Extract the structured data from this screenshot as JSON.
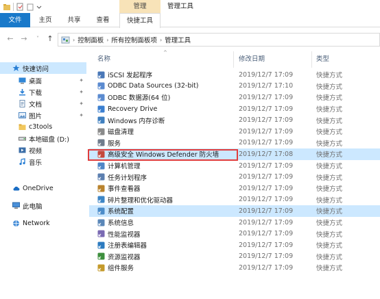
{
  "ribbon": {
    "context_group": "管理",
    "window_title": "管理工具",
    "tabs": [
      {
        "label": "文件"
      },
      {
        "label": "主页"
      },
      {
        "label": "共享"
      },
      {
        "label": "查看"
      },
      {
        "label": "快捷工具"
      }
    ]
  },
  "address": {
    "crumbs": [
      "控制面板",
      "所有控制面板项",
      "管理工具"
    ]
  },
  "nav": {
    "items": [
      {
        "label": "快速访问",
        "icon": "star-icon"
      },
      {
        "label": "桌面",
        "icon": "desktop-icon",
        "pinned": true
      },
      {
        "label": "下载",
        "icon": "download-icon",
        "pinned": true
      },
      {
        "label": "文档",
        "icon": "document-icon",
        "pinned": true
      },
      {
        "label": "图片",
        "icon": "picture-icon",
        "pinned": true
      },
      {
        "label": "c3tools",
        "icon": "folder-icon"
      },
      {
        "label": "本地磁盘 (D:)",
        "icon": "drive-icon"
      },
      {
        "label": "视频",
        "icon": "video-icon"
      },
      {
        "label": "音乐",
        "icon": "music-icon"
      },
      {
        "label": "OneDrive",
        "icon": "cloud-icon"
      },
      {
        "label": "此电脑",
        "icon": "computer-icon"
      },
      {
        "label": "Network",
        "icon": "network-icon"
      }
    ]
  },
  "list": {
    "headers": {
      "name": "名称",
      "date": "修改日期",
      "type": "类型"
    },
    "rows": [
      {
        "name": "iSCSI 发起程序",
        "date": "2019/12/7 17:09",
        "type": "快捷方式"
      },
      {
        "name": "ODBC Data Sources (32-bit)",
        "date": "2019/12/7 17:10",
        "type": "快捷方式"
      },
      {
        "name": "ODBC 数据源(64 位)",
        "date": "2019/12/7 17:09",
        "type": "快捷方式"
      },
      {
        "name": "Recovery Drive",
        "date": "2019/12/7 17:09",
        "type": "快捷方式"
      },
      {
        "name": "Windows 内存诊断",
        "date": "2019/12/7 17:09",
        "type": "快捷方式"
      },
      {
        "name": "磁盘清理",
        "date": "2019/12/7 17:09",
        "type": "快捷方式"
      },
      {
        "name": "服务",
        "date": "2019/12/7 17:09",
        "type": "快捷方式"
      },
      {
        "name": "高级安全 Windows Defender 防火墙",
        "date": "2019/12/7 17:08",
        "type": "快捷方式"
      },
      {
        "name": "计算机管理",
        "date": "2019/12/7 17:09",
        "type": "快捷方式"
      },
      {
        "name": "任务计划程序",
        "date": "2019/12/7 17:09",
        "type": "快捷方式"
      },
      {
        "name": "事件查看器",
        "date": "2019/12/7 17:09",
        "type": "快捷方式"
      },
      {
        "name": "碎片整理和优化驱动器",
        "date": "2019/12/7 17:09",
        "type": "快捷方式"
      },
      {
        "name": "系统配置",
        "date": "2019/12/7 17:09",
        "type": "快捷方式"
      },
      {
        "name": "系统信息",
        "date": "2019/12/7 17:09",
        "type": "快捷方式"
      },
      {
        "name": "性能监视器",
        "date": "2019/12/7 17:09",
        "type": "快捷方式"
      },
      {
        "name": "注册表编辑器",
        "date": "2019/12/7 17:09",
        "type": "快捷方式"
      },
      {
        "name": "资源监视器",
        "date": "2019/12/7 17:09",
        "type": "快捷方式"
      },
      {
        "name": "组件服务",
        "date": "2019/12/7 17:09",
        "type": "快捷方式"
      }
    ]
  },
  "colors": {
    "accent": "#1979ca",
    "selection": "#cce8ff",
    "context_tab": "#f8e3b8",
    "highlight_box": "#e03c3c"
  }
}
